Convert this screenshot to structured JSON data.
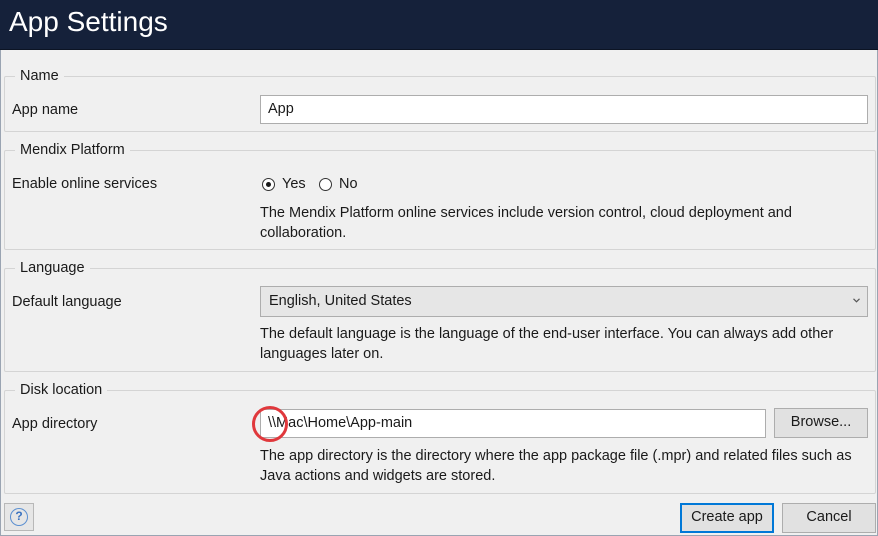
{
  "window": {
    "title": "App Settings"
  },
  "groups": {
    "name": {
      "legend": "Name",
      "app_name_label": "App name",
      "app_name_value": "App"
    },
    "platform": {
      "legend": "Mendix Platform",
      "online_label": "Enable online services",
      "yes_label": "Yes",
      "no_label": "No",
      "selected": "Yes",
      "desc_line1": "The Mendix Platform online services include version control, cloud deployment and",
      "desc_line2": "collaboration."
    },
    "language": {
      "legend": "Language",
      "default_label": "Default language",
      "selected_value": "English, United States",
      "desc_line1": "The default language is the language of the end-user interface. You can always add other",
      "desc_line2": "languages later on."
    },
    "disk": {
      "legend": "Disk location",
      "dir_label": "App directory",
      "dir_value": "\\\\Mac\\Home\\App-main",
      "browse_label": "Browse...",
      "desc_line1": "The app directory is the directory where the app package file (.mpr) and related files such as",
      "desc_line2": "Java actions and widgets are stored."
    }
  },
  "footer": {
    "help_glyph": "?",
    "create_label": "Create app",
    "cancel_label": "Cancel"
  },
  "colors": {
    "titlebar": "#15213a",
    "accent": "#0078d7",
    "highlight": "#e0383c"
  }
}
